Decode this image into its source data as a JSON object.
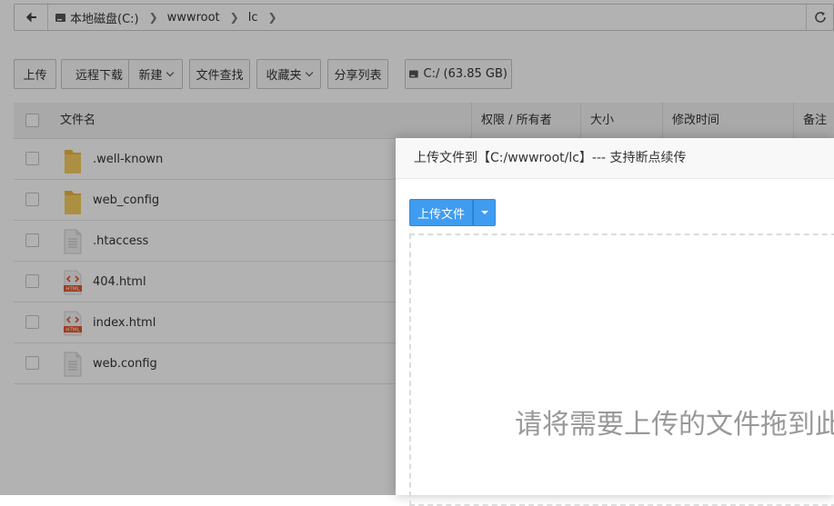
{
  "address": {
    "crumbs": [
      "本地磁盘(C:)",
      "wwwroot",
      "lc"
    ]
  },
  "toolbar": {
    "upload": "上传",
    "remote_download": "远程下载",
    "new": "新建",
    "find": "文件查找",
    "favorites": "收藏夹",
    "share_list": "分享列表",
    "disk": "C:/ (63.85 GB)"
  },
  "table": {
    "columns": {
      "name": "文件名",
      "perm": "权限 / 所有者",
      "size": "大小",
      "mtime": "修改时间",
      "note": "备注"
    },
    "rows": [
      {
        "name": ".well-known",
        "icon": "folder-icon"
      },
      {
        "name": "web_config",
        "icon": "folder-icon"
      },
      {
        "name": ".htaccess",
        "icon": "file-icon"
      },
      {
        "name": "404.html",
        "icon": "html-file-icon"
      },
      {
        "name": "index.html",
        "icon": "html-file-icon"
      },
      {
        "name": "web.config",
        "icon": "file-icon"
      }
    ]
  },
  "dialog": {
    "title": "上传文件到【C:/wwwroot/lc】--- 支持断点续传",
    "upload_button": "上传文件",
    "dropzone_text": "请将需要上传的文件拖到此"
  },
  "html_badge": "HTML",
  "colors": {
    "primary": "#3f9cf0",
    "folder": "#f5c452",
    "html_badge": "#e2572b"
  }
}
